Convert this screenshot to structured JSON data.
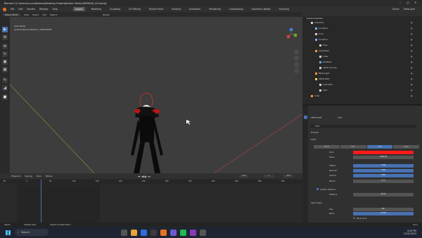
{
  "window": {
    "title": "Blender* [C:\\Users\\Lucun\\Desktop\\Desktop Folder\\Blender Files\\LAMPHEAD_V3.blend]"
  },
  "menu": {
    "items": [
      "File",
      "Edit",
      "Render",
      "Window",
      "Help"
    ],
    "workspaces": [
      "Layout",
      "Modeling",
      "Sculpting",
      "UV Editing",
      "Texture Paint",
      "Shading",
      "Animation",
      "Rendering",
      "Compositing",
      "Geometry Nodes",
      "Scripting"
    ],
    "active_workspace": "Layout",
    "scene": "Scene",
    "view_layer": "ViewLayer"
  },
  "viewport": {
    "mode": "Object Mode",
    "header_items": [
      "View",
      "Select",
      "Add",
      "Object"
    ],
    "transform": "Global",
    "overlay_line1": "User Persp",
    "overlay_line2": "(214) Scene Collection | SPOTLIGHT"
  },
  "outliner": {
    "header": "Scene Collection",
    "rows": [
      {
        "label": "Collection",
        "depth": 0,
        "color": "#d0d0d0"
      },
      {
        "label": "Armature",
        "depth": 1,
        "color": "#7fb0ff"
      },
      {
        "label": "Torso",
        "depth": 1,
        "color": "#d0d0d0"
      },
      {
        "label": "Armature",
        "depth": 1,
        "color": "#7fb0ff"
      },
      {
        "label": "Pose",
        "depth": 2,
        "color": "#d0d0d0"
      },
      {
        "label": "Lamphead",
        "depth": 1,
        "color": "#ff9a3c"
      },
      {
        "label": "Cube",
        "depth": 2,
        "color": "#d0d0d0"
      },
      {
        "label": "Modifiers",
        "depth": 2,
        "color": "#6fa8dc"
      },
      {
        "label": "Vertex Groups",
        "depth": 2,
        "color": "#d0d0d0"
      },
      {
        "label": "Mball Light",
        "depth": 1,
        "color": "#ff9a3c"
      },
      {
        "label": "SPOTLIGHT",
        "depth": 1,
        "color": "#ffcc66"
      },
      {
        "label": "Animation",
        "depth": 2,
        "color": "#d0d0d0"
      },
      {
        "label": "Spot",
        "depth": 2,
        "color": "#d0d0d0"
      },
      {
        "label": "Cube",
        "depth": 0,
        "color": "#ff9a3c"
      }
    ]
  },
  "properties": {
    "object_name": "SPOTLIGHT",
    "data_name": "Spot",
    "data_field": "Spot",
    "section_preview": "Preview",
    "section_light": "Light",
    "light_types": [
      "Point",
      "Sun",
      "Spot",
      "Area"
    ],
    "active_light_type": "Spot",
    "fields": [
      {
        "label": "Color",
        "value": "",
        "color": "#ff1a1a"
      },
      {
        "label": "Power",
        "value": "1000 W",
        "color": "#545454"
      },
      {
        "label": "Diffuse",
        "value": "1.00",
        "color": "#4772b3"
      },
      {
        "label": "Specular",
        "value": "1.00",
        "color": "#4772b3"
      },
      {
        "label": "Volume",
        "value": "1.00",
        "color": "#4772b3"
      },
      {
        "label": "Radius",
        "value": "0 m",
        "color": "#545454"
      }
    ],
    "custom_distance": "Custom Distance",
    "distance": {
      "label": "Distance",
      "value": "40 m"
    },
    "section_spot": "Spot Shape",
    "size": {
      "label": "Size",
      "value": "45°"
    },
    "blend": {
      "label": "Blend",
      "value": "0.150"
    },
    "show_cone": "Show Cone"
  },
  "timeline": {
    "menus": [
      "Playback",
      "Keying",
      "View",
      "Marker"
    ],
    "current_frame": "214",
    "start": "1",
    "end": "250",
    "ticks": [
      "-50",
      "0",
      "50",
      "100",
      "150",
      "200",
      "250",
      "300",
      "350",
      "400",
      "450",
      "500",
      "550"
    ]
  },
  "status": {
    "select": "Select",
    "rotate": "Rotate View",
    "context": "Object Context Menu",
    "version": "4.0.2"
  },
  "taskbar": {
    "search_placeholder": "Search",
    "time": "9:59 PM",
    "date": "12/31/2023"
  },
  "colors": {
    "accent": "#4772b3",
    "light_color": "#ff1a1a"
  }
}
